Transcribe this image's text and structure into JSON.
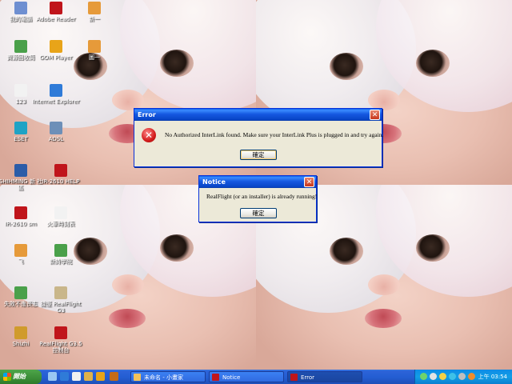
{
  "desktop_icons": [
    {
      "label": "我的電腦",
      "color": "#6e8fd1"
    },
    {
      "label": "Adobe Reader",
      "color": "#c0151b"
    },
    {
      "label": "新一",
      "color": "#e69a3a"
    },
    {
      "label": "資源回收筒",
      "color": "#4aa04a"
    },
    {
      "label": "GOM Player",
      "color": "#e8a419"
    },
    {
      "label": "圖一",
      "color": "#e69a3a"
    },
    {
      "label": "123",
      "color": "#f2f2f2"
    },
    {
      "label": "Internet Explorer",
      "color": "#2f7bd8"
    },
    {
      "label": "ESET",
      "color": "#1ea3c5"
    },
    {
      "label": "ADSL",
      "color": "#6d8fb8"
    },
    {
      "label": "SHIHMING 新 社 區 ",
      "color": "#2b5ca8"
    },
    {
      "label": "IR-2610 HELP",
      "color": "#c0151b"
    },
    {
      "label": "IR-2610 sm",
      "color": "#c0151b"
    },
    {
      "label": "火車時刻表",
      "color": "#f2f2f2"
    },
    {
      "label": "飞",
      "color": "#e69a3a"
    },
    {
      "label": "新詩學院",
      "color": "#4aa04a"
    },
    {
      "label": "失敗不應喪志",
      "color": "#4aa04a"
    },
    {
      "label": "捷徑 RealFlight G3",
      "color": "#c9b68a"
    },
    {
      "label": "Shizhi",
      "color": "#d09b2c"
    },
    {
      "label": "RealFlight G3.5 控制台",
      "color": "#c0151b"
    }
  ],
  "error_dialog": {
    "title": "Error",
    "close_glyph": "✕",
    "icon_glyph": "✕",
    "message": "No Authorized InterLink found. Make sure your InterLink Plus is plugged in and try again.",
    "ok_label": "確定"
  },
  "notice_dialog": {
    "title": "Notice",
    "close_glyph": "✕",
    "message": "RealFlight (or an installer) is already running!",
    "ok_label": "確定"
  },
  "taskbar": {
    "start_label": "開始",
    "tasks": [
      {
        "label": "未命名 - 小畫家",
        "icon_color": "#f2c15a"
      },
      {
        "label": "Notice",
        "icon_color": "#c0151b"
      },
      {
        "label": "Error",
        "icon_color": "#c0151b"
      }
    ],
    "clock": "上午 03:54"
  },
  "colors": {
    "titlebar": "#0a5fe8",
    "taskbar": "#245ed3",
    "start": "#3b8d37"
  }
}
